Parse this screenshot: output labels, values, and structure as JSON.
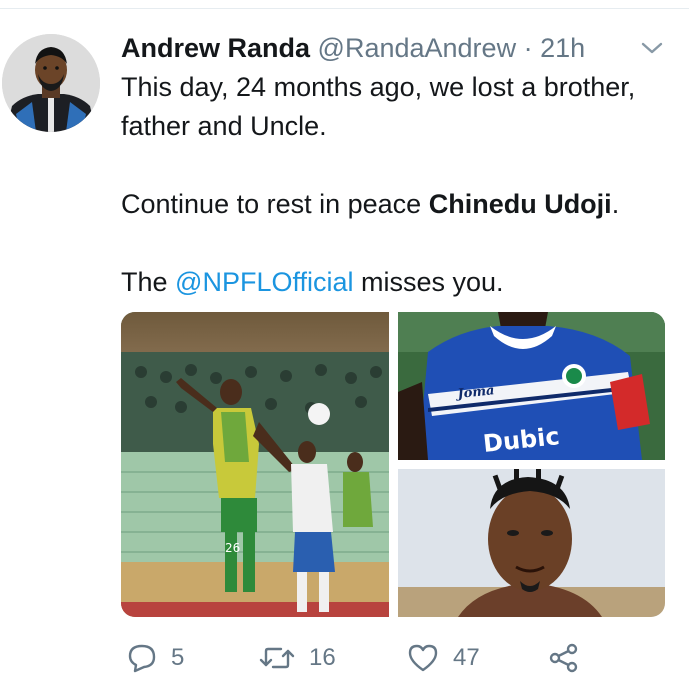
{
  "tweet": {
    "author_name": "Andrew Randa",
    "author_handle": "@RandaAndrew",
    "separator": "·",
    "timestamp": "21h",
    "text": {
      "line1": "This day, 24 months ago, we lost a brother, father and Uncle.",
      "line2_prefix": "Continue to rest in peace ",
      "line2_bold": "Chinedu Udoji",
      "line2_suffix": ".",
      "line3_prefix": "The ",
      "line3_mention": "@NPFLOfficial",
      "line3_suffix": " misses you."
    },
    "media": {
      "photo_left": {
        "jersey_number": "26"
      },
      "photo_top_right": {
        "jersey_brand": "Joma",
        "jersey_sponsor": "Dubic"
      }
    },
    "actions": {
      "reply_count": "5",
      "retweet_count": "16",
      "like_count": "47"
    }
  },
  "colors": {
    "text_primary": "#14171a",
    "text_secondary": "#657786",
    "link": "#1b95e0",
    "divider": "#e6ecf0"
  },
  "icons": {
    "reply": "speech-bubble-outline",
    "retweet": "retweet-arrows",
    "like": "heart-outline",
    "share": "share-nodes",
    "more": "chevron-down"
  }
}
